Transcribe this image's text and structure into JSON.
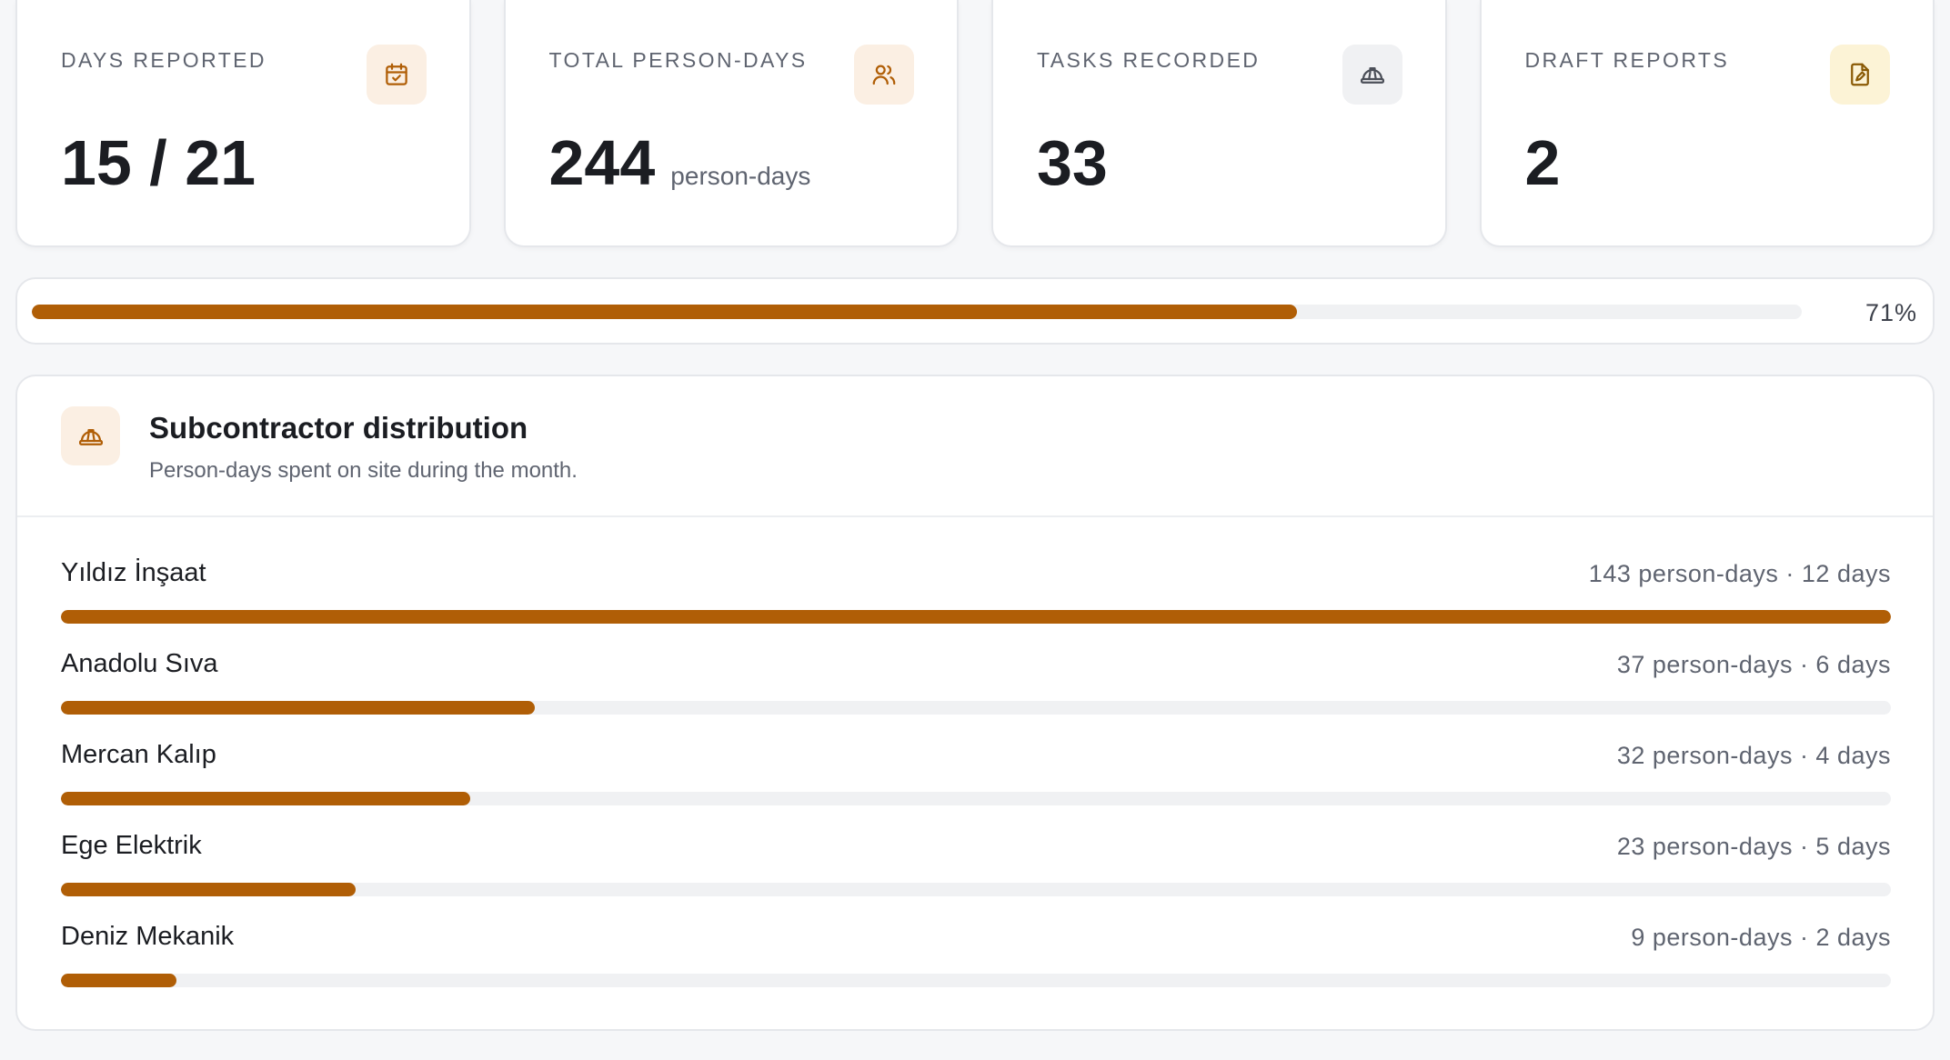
{
  "colors": {
    "accent": "#b05e06",
    "icon_bg_orange": "#fbefe3",
    "icon_bg_gray": "#f0f1f3",
    "icon_bg_yellow": "#fcf3d6",
    "icon_orange": "#b05e06",
    "icon_gray": "#4b4f58",
    "icon_yellow": "#8a5a05"
  },
  "stats": [
    {
      "label": "DAYS REPORTED",
      "value": "15 / 21",
      "unit": "",
      "icon": "calendar-check-icon"
    },
    {
      "label": "TOTAL PERSON-DAYS",
      "value": "244",
      "unit": "person-days",
      "icon": "users-icon"
    },
    {
      "label": "TASKS RECORDED",
      "value": "33",
      "unit": "",
      "icon": "hard-hat-icon"
    },
    {
      "label": "DRAFT REPORTS",
      "value": "2",
      "unit": "",
      "icon": "file-edit-icon"
    }
  ],
  "progress": {
    "fraction": 0.715,
    "label": "71%"
  },
  "subcontractors": {
    "title": "Subcontractor distribution",
    "subtitle": "Person-days spent on site during the month.",
    "icon": "hard-hat-icon",
    "rows": [
      {
        "name": "Yıldız İnşaat",
        "meta": "143 person-days · 12 days",
        "person_days": 143
      },
      {
        "name": "Anadolu Sıva",
        "meta": "37 person-days · 6 days",
        "person_days": 37
      },
      {
        "name": "Mercan Kalıp",
        "meta": "32 person-days · 4 days",
        "person_days": 32
      },
      {
        "name": "Ege Elektrik",
        "meta": "23 person-days · 5 days",
        "person_days": 23
      },
      {
        "name": "Deniz Mekanik",
        "meta": "9 person-days · 2 days",
        "person_days": 9
      }
    ]
  }
}
